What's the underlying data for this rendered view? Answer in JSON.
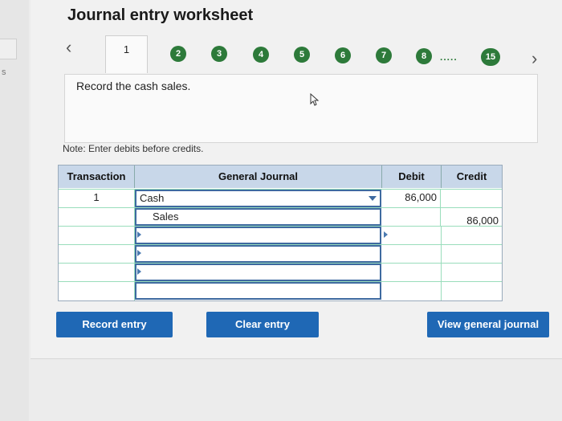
{
  "page": {
    "title": "Journal entry worksheet",
    "edge_text": "s"
  },
  "steps": {
    "active": "1",
    "items": [
      "2",
      "3",
      "4",
      "5",
      "6",
      "7",
      "8"
    ],
    "ellipsis": ".....",
    "last": "15",
    "prev_icon": "chevron-left-icon",
    "next_icon": "chevron-right-icon"
  },
  "prompt": {
    "text": "Record the cash sales."
  },
  "note": "Note: Enter debits before credits.",
  "table": {
    "headers": {
      "transaction": "Transaction",
      "journal": "General Journal",
      "debit": "Debit",
      "credit": "Credit"
    },
    "rows": [
      {
        "transaction": "1",
        "account": "Cash",
        "debit": "86,000",
        "credit": ""
      },
      {
        "transaction": "",
        "account": "Sales",
        "debit": "",
        "credit": "86,000"
      },
      {
        "transaction": "",
        "account": "",
        "debit": "",
        "credit": ""
      },
      {
        "transaction": "",
        "account": "",
        "debit": "",
        "credit": ""
      },
      {
        "transaction": "",
        "account": "",
        "debit": "",
        "credit": ""
      },
      {
        "transaction": "",
        "account": "",
        "debit": "",
        "credit": ""
      }
    ]
  },
  "buttons": {
    "record": "Record entry",
    "clear": "Clear entry",
    "view": "View general journal"
  },
  "colors": {
    "step_green": "#2d7a3a",
    "button_blue": "#1f68b5",
    "header_blue": "#c8d7e9"
  }
}
